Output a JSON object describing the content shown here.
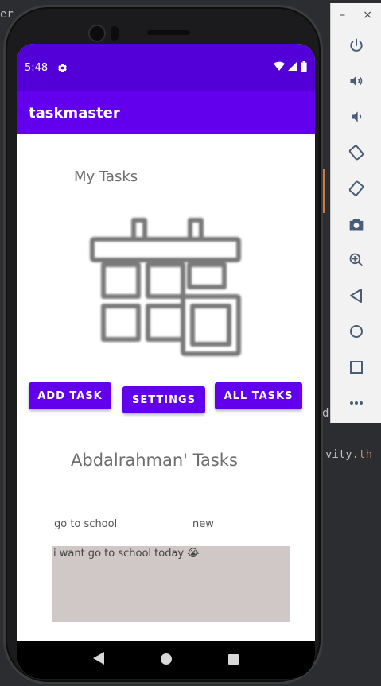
{
  "ide": {
    "fragment_right": "vity.",
    "fragment_right_kw": "th",
    "fragment_topleft": "er",
    "fragment_d": "d"
  },
  "status_bar": {
    "time": "5:48"
  },
  "app": {
    "title": "taskmaster"
  },
  "main": {
    "heading": "My Tasks",
    "buttons": {
      "add_task": "ADD TASK",
      "settings": "SETTINGS",
      "all_tasks": "ALL TASKS"
    },
    "user_tasks_heading": "Abdalrahman' Tasks",
    "task": {
      "title": "go to school",
      "state": "new",
      "body": "i want go to school today 😭"
    }
  },
  "emulator_toolbar": {
    "minimize": "–",
    "close": "×",
    "items": [
      "power-icon",
      "volume-up-icon",
      "volume-down-icon",
      "rotate-left-icon",
      "rotate-right-icon",
      "camera-icon",
      "zoom-icon",
      "back-icon",
      "home-icon",
      "overview-icon",
      "more-icon"
    ]
  },
  "colors": {
    "status_bar": "#5300d8",
    "app_bar": "#6200ee",
    "accent": "#6200ee",
    "task_body_bg": "#cfc8c7"
  }
}
